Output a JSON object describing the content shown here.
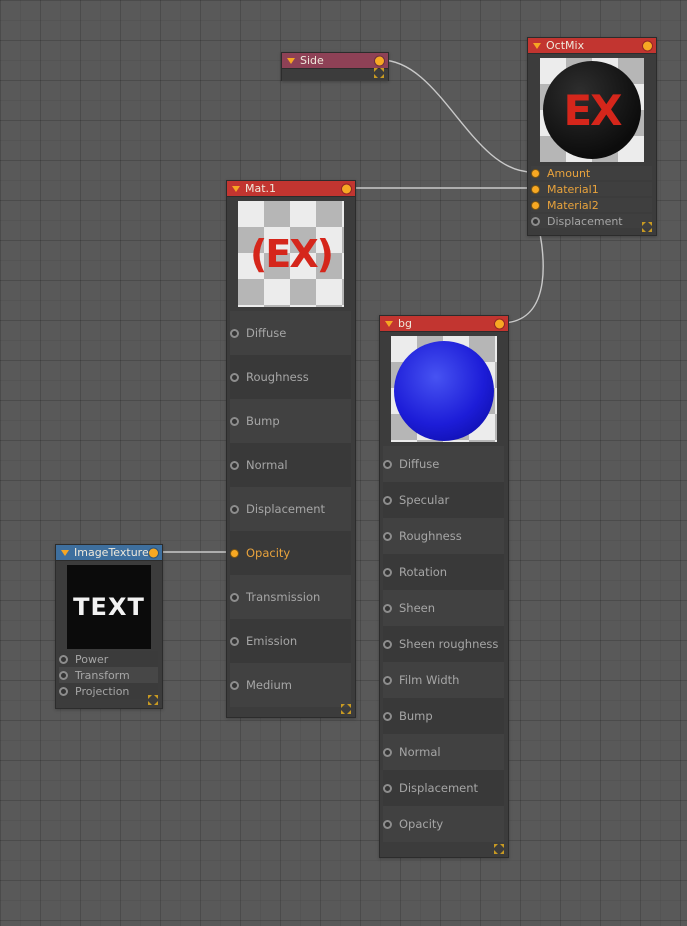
{
  "editor": {
    "type": "material-node-graph"
  },
  "colors": {
    "canvas_bg": "#595959",
    "node_body": "#3c3c3c",
    "header_red": "#c23530",
    "header_maroon": "#8e4156",
    "header_blue": "#3e6f9e",
    "accent_orange": "#f7a823",
    "connected_label": "#e9a33c",
    "label_gray": "#a6a6a6",
    "wire": "#c9c9c9",
    "preview_red_text": "#d5261b",
    "preview_blue_sphere": "#1d1dd8"
  },
  "nodes": {
    "side": {
      "title": "Side"
    },
    "octmix": {
      "title": "OctMix",
      "thumbnail_text": "EX",
      "inputs": [
        {
          "label": "Amount",
          "connected": true
        },
        {
          "label": "Material1",
          "connected": true
        },
        {
          "label": "Material2",
          "connected": true
        },
        {
          "label": "Displacement",
          "connected": false
        }
      ]
    },
    "mat1": {
      "title": "Mat.1",
      "thumbnail_text": "(EX)",
      "inputs": [
        {
          "label": "Diffuse",
          "connected": false
        },
        {
          "label": "Roughness",
          "connected": false
        },
        {
          "label": "Bump",
          "connected": false
        },
        {
          "label": "Normal",
          "connected": false
        },
        {
          "label": "Displacement",
          "connected": false
        },
        {
          "label": "Opacity",
          "connected": true
        },
        {
          "label": "Transmission",
          "connected": false
        },
        {
          "label": "Emission",
          "connected": false
        },
        {
          "label": "Medium",
          "connected": false
        }
      ]
    },
    "bg": {
      "title": "bg",
      "inputs": [
        {
          "label": "Diffuse",
          "connected": false
        },
        {
          "label": "Specular",
          "connected": false
        },
        {
          "label": "Roughness",
          "connected": false
        },
        {
          "label": "Rotation",
          "connected": false
        },
        {
          "label": "Sheen",
          "connected": false
        },
        {
          "label": "Sheen roughness",
          "connected": false
        },
        {
          "label": "Film Width",
          "connected": false
        },
        {
          "label": "Bump",
          "connected": false
        },
        {
          "label": "Normal",
          "connected": false
        },
        {
          "label": "Displacement",
          "connected": false
        },
        {
          "label": "Opacity",
          "connected": false
        }
      ]
    },
    "imagetexture": {
      "title": "ImageTexture",
      "thumbnail_text": "TEXT",
      "inputs": [
        {
          "label": "Power",
          "connected": false
        },
        {
          "label": "Transform",
          "connected": false
        },
        {
          "label": "Projection",
          "connected": false
        }
      ]
    }
  },
  "connections": [
    {
      "from": "Side",
      "to": "OctMix.Amount"
    },
    {
      "from": "Mat.1",
      "to": "OctMix.Material1"
    },
    {
      "from": "bg",
      "to": "OctMix.Material2"
    },
    {
      "from": "ImageTexture",
      "to": "Mat.1.Opacity"
    }
  ]
}
